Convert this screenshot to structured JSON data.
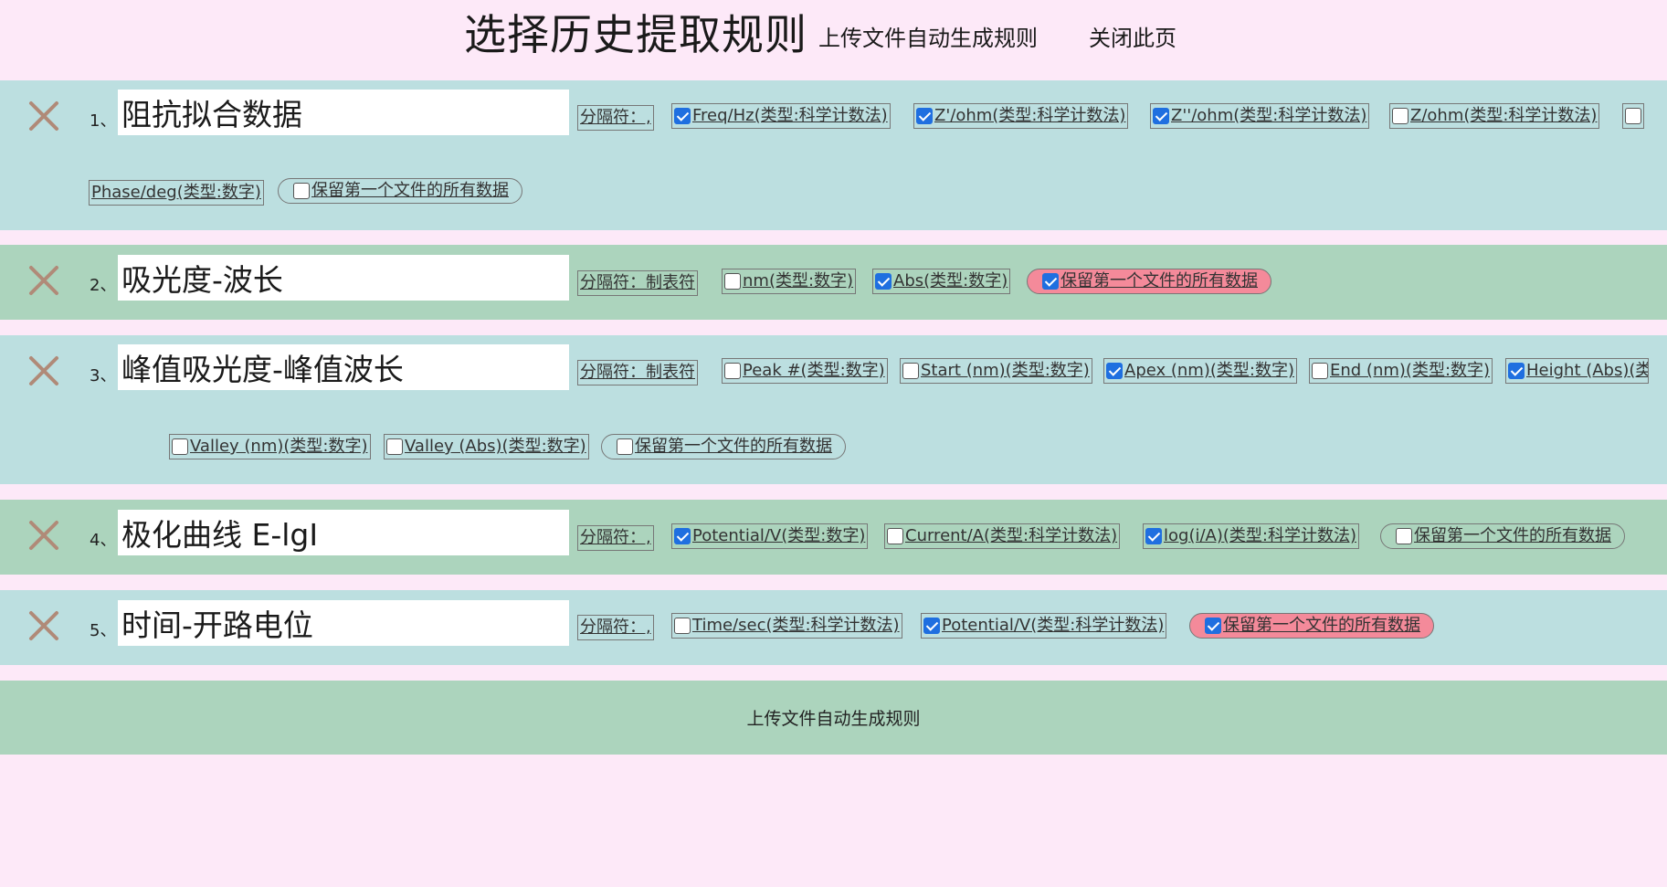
{
  "header": {
    "title": "选择历史提取规则",
    "upload_link": "上传文件自动生成规则",
    "close_link": "关闭此页"
  },
  "rules": [
    {
      "num": "1、",
      "name": "阻抗拟合数据",
      "sep": "分隔符：,",
      "fields": [
        {
          "label": "Freq/Hz(类型:科学计数法)",
          "checked": true
        },
        {
          "label": "Z'/ohm(类型:科学计数法)",
          "checked": true
        },
        {
          "label": "Z''/ohm(类型:科学计数法)",
          "checked": true
        },
        {
          "label": "Z/ohm(类型:科学计数法)",
          "checked": false
        },
        {
          "label": "Phase/deg(类型:数字)",
          "checked": false
        }
      ],
      "keep": {
        "label": "保留第一个文件的所有数据",
        "checked": false
      }
    },
    {
      "num": "2、",
      "name": "吸光度-波长",
      "sep": "分隔符：制表符",
      "fields": [
        {
          "label": "nm(类型:数字)",
          "checked": false
        },
        {
          "label": "Abs(类型:数字)",
          "checked": true
        }
      ],
      "keep": {
        "label": "保留第一个文件的所有数据",
        "checked": true
      }
    },
    {
      "num": "3、",
      "name": "峰值吸光度-峰值波长",
      "sep": "分隔符：制表符",
      "fields": [
        {
          "label": "Peak #(类型:数字)",
          "checked": false
        },
        {
          "label": "Start (nm)(类型:数字)",
          "checked": false
        },
        {
          "label": "Apex (nm)(类型:数字)",
          "checked": true
        },
        {
          "label": "End (nm)(类型:数字)",
          "checked": false
        },
        {
          "label": "Height (Abs)(类型:数字)",
          "checked": true
        },
        {
          "label": "Valley (nm)(类型:数字)",
          "checked": false
        },
        {
          "label": "Valley (Abs)(类型:数字)",
          "checked": false
        }
      ],
      "keep": {
        "label": "保留第一个文件的所有数据",
        "checked": false
      }
    },
    {
      "num": "4、",
      "name": "极化曲线 E-lgI",
      "sep": "分隔符：,",
      "fields": [
        {
          "label": "Potential/V(类型:数字)",
          "checked": true
        },
        {
          "label": "Current/A(类型:科学计数法)",
          "checked": false
        },
        {
          "label": "log(i/A)(类型:科学计数法)",
          "checked": true
        }
      ],
      "keep": {
        "label": "保留第一个文件的所有数据",
        "checked": false
      }
    },
    {
      "num": "5、",
      "name": "时间-开路电位",
      "sep": "分隔符：,",
      "fields": [
        {
          "label": "Time/sec(类型:科学计数法)",
          "checked": false
        },
        {
          "label": "Potential/V(类型:科学计数法)",
          "checked": true
        }
      ],
      "keep": {
        "label": "保留第一个文件的所有数据",
        "checked": true
      }
    }
  ],
  "bottom": {
    "label": "上传文件自动生成规则"
  },
  "colors": {
    "page_bg": "#fde9f8",
    "row_teal": "#bcdfe0",
    "row_green": "#acd4bd",
    "keep_active": "#f48a9a",
    "delete_icon": "#b08a78",
    "checkbox_on": "#1f6fe0"
  },
  "icons": {
    "delete": "close-x-icon"
  }
}
